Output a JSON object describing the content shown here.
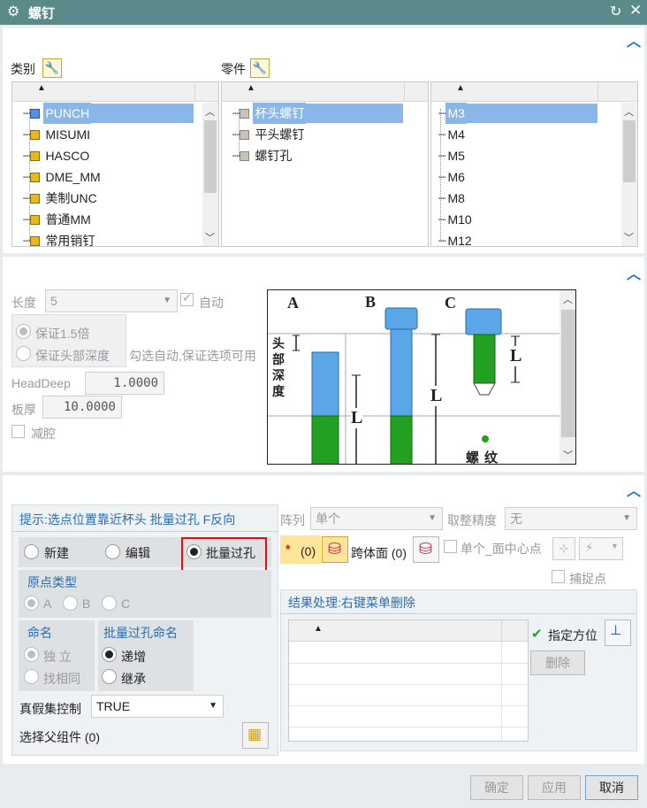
{
  "window": {
    "title": "螺钉"
  },
  "top": {
    "category_label": "类别",
    "part_label": "零件",
    "categories": [
      "PUNCH",
      "MISUMI",
      "HASCO",
      "DME_MM",
      "美制UNC",
      "普通MM",
      "常用销钉"
    ],
    "parts": [
      "杯头螺钉",
      "平头螺钉",
      "螺钉孔"
    ],
    "sizes": [
      "M3",
      "M4",
      "M5",
      "M6",
      "M8",
      "M10",
      "M12"
    ]
  },
  "params": {
    "length_label": "长度",
    "length_value": "5",
    "auto_label": "自动",
    "opt1": "保证1.5倍",
    "opt2": "保证头部深度",
    "hint": "勾选自动,保证选项可用",
    "headdeep_label": "HeadDeep",
    "headdeep_value": "1.0000",
    "thick_label": "板厚",
    "thick_value": "10.0000",
    "cavity_label": "减腔"
  },
  "diagram": {
    "a": "A",
    "b": "B",
    "c": "C",
    "head_depth": "头部深度",
    "l": "L",
    "thread": "螺纹"
  },
  "bottom": {
    "hint": "提示:选点位置靠近杯头 批量过孔 F反向",
    "modes": [
      "新建",
      "编辑",
      "批量过孔"
    ],
    "origin_title": "原点类型",
    "origin_opts": [
      "A",
      "B",
      "C"
    ],
    "naming_title": "命名",
    "naming_opts": [
      "独 立",
      "找相同"
    ],
    "batch_title": "批量过孔命名",
    "batch_opts": [
      "递增",
      "继承"
    ],
    "truefalse_label": "真假集控制",
    "truefalse_value": "TRUE",
    "parent_label": "选择父组件 (0)",
    "array_label": "阵列",
    "array_value": "单个",
    "precision_label": "取整精度",
    "precision_value": "无",
    "star": "*",
    "count0": "(0)",
    "cross_label": "跨体面 (0)",
    "single_center": "单个_面中心点",
    "snap_label": "捕捉点",
    "result_title": "结果处理:右键菜单删除",
    "orient_label": "指定方位",
    "delete_label": "删除"
  },
  "footer": {
    "ok": "确定",
    "apply": "应用",
    "cancel": "取消"
  }
}
